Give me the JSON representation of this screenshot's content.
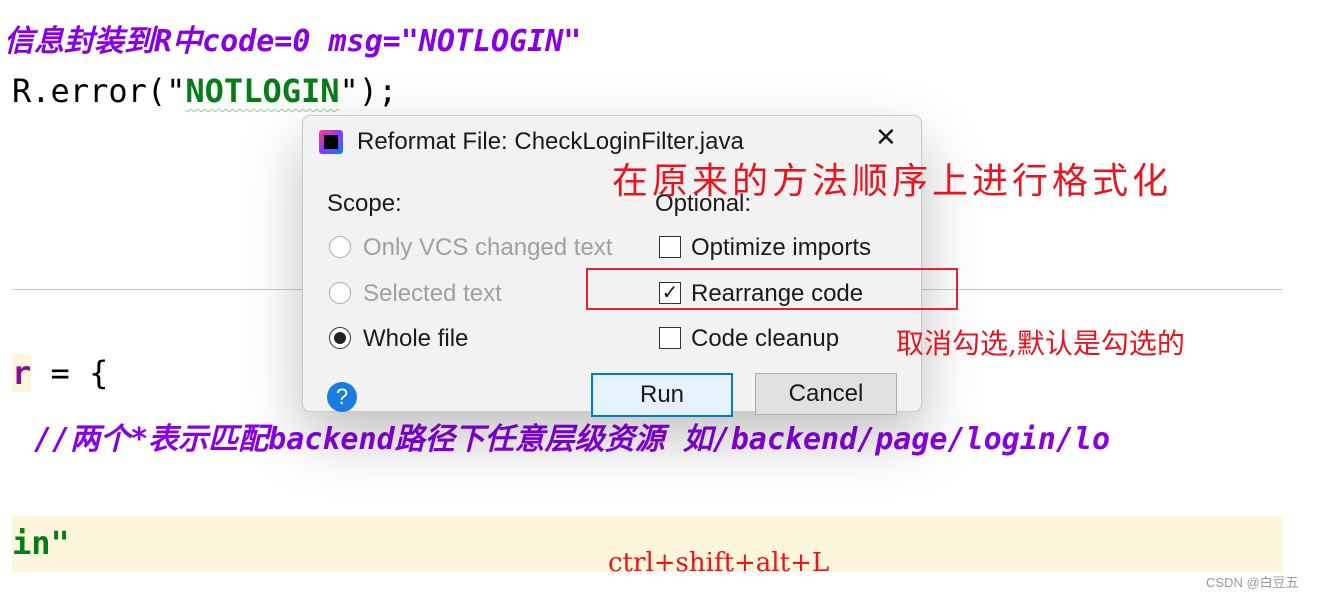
{
  "editor": {
    "comment_line1": "信息封装到R中code=0 msg=\"NOTLOGIN\"",
    "code_line2_prefix": "R.error(\"",
    "code_line2_string": "NOTLOGIN",
    "code_line2_suffix": "\");",
    "code_line3_var": "r",
    "code_line3_rest": " = {",
    "comment_line4": "//两个*表示匹配backend路径下任意层级资源 如/backend/page/login/lo",
    "code_line5_string": "in\""
  },
  "dialog": {
    "title": "Reformat File: CheckLoginFilter.java",
    "close_label": "✕",
    "scope_label": "Scope:",
    "scope_options": [
      {
        "label": "Only VCS changed text",
        "selected": false,
        "enabled": false
      },
      {
        "label": "Selected text",
        "selected": false,
        "enabled": false
      },
      {
        "label": "Whole file",
        "selected": true,
        "enabled": true
      }
    ],
    "optional_label": "Optional:",
    "optional_options": [
      {
        "label": "Optimize imports",
        "checked": false
      },
      {
        "label": "Rearrange code",
        "checked": true
      },
      {
        "label": "Code cleanup",
        "checked": false
      }
    ],
    "help_label": "?",
    "run_label": "Run",
    "cancel_label": "Cancel"
  },
  "annotations": {
    "title_note": "在原来的方法顺序上进行格式化",
    "rearrange_note": "取消勾选,默认是勾选的",
    "shortcut_note": "ctrl+shift+alt+L"
  },
  "watermark": "CSDN @白豆五",
  "colors": {
    "comment": "#8a00e6",
    "string": "#067d17",
    "annotation": "#e8141e",
    "accent": "#0078d7"
  }
}
